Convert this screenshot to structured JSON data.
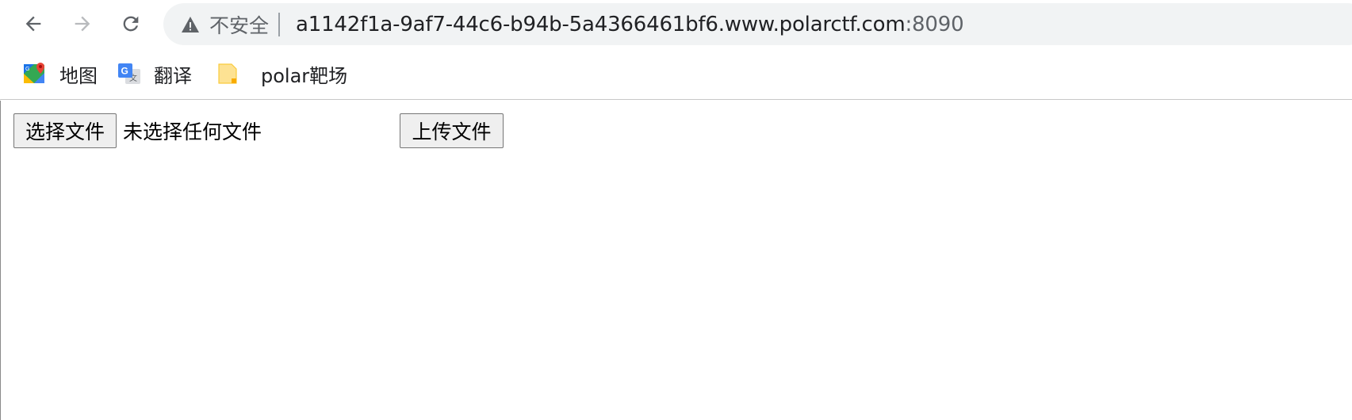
{
  "browser": {
    "security_label": "不安全",
    "url_host": "a1142f1a-9af7-44c6-b94b-5a4366461bf6.www.polarctf.com",
    "url_port": ":8090",
    "icons": {
      "back": "arrow-left-icon",
      "forward": "arrow-right-icon",
      "reload": "reload-icon",
      "security": "warning-triangle-icon"
    }
  },
  "bookmarks": {
    "items": [
      {
        "label": "地图",
        "icon": "google-maps-icon"
      },
      {
        "label": "翻译",
        "icon": "google-translate-icon"
      },
      {
        "label": "polar靶场",
        "icon": "folder-icon"
      }
    ]
  },
  "form": {
    "choose_file_label": "选择文件",
    "file_status": "未选择任何文件",
    "upload_label": "上传文件"
  }
}
